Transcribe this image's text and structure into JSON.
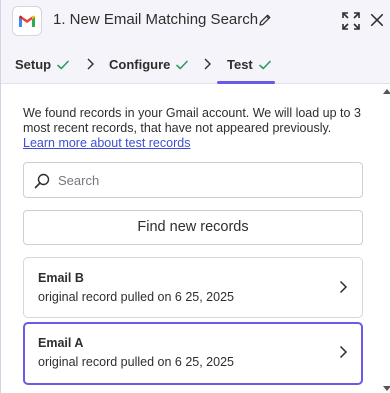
{
  "header": {
    "title": "1. New Email Matching Search",
    "app_icon": "gmail-icon",
    "accent": "#695be8"
  },
  "tabs": [
    {
      "label": "Setup",
      "status": "check-icon"
    },
    {
      "label": "Configure",
      "status": "check-icon"
    },
    {
      "label": "Test",
      "status": "check-icon",
      "active": true
    }
  ],
  "intro": {
    "text": "We found records in your Gmail account. We will load up to 3 most recent records, that have not appeared previously.",
    "link": "Learn more about test records"
  },
  "search": {
    "placeholder": "Search",
    "value": ""
  },
  "find_button": {
    "label": "Find new records"
  },
  "records": [
    {
      "title": "Email B",
      "subtitle": "original record pulled on 6 25, 2025",
      "selected": false
    },
    {
      "title": "Email A",
      "subtitle": "original record pulled on 6 25, 2025",
      "selected": true
    }
  ],
  "colors": {
    "check": "#2e9b5f",
    "link": "#3d4fd6",
    "header_bg": "#f5f4fa"
  }
}
